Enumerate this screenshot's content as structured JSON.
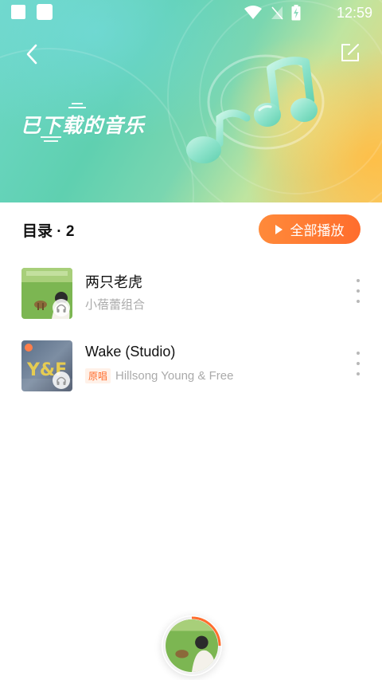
{
  "status_bar": {
    "time": "12:59"
  },
  "header": {
    "title": "已下载的音乐",
    "back_icon": "chevron-left-icon",
    "edit_icon": "edit-icon"
  },
  "list": {
    "header": "目录 · 2",
    "play_all_label": "全部播放"
  },
  "songs": [
    {
      "title": "两只老虎",
      "artist": "小蓓蕾组合",
      "badge": ""
    },
    {
      "title": "Wake (Studio)",
      "artist": "Hillsong Young & Free",
      "badge": "原唱"
    }
  ],
  "colors": {
    "accent": "#ff6d2d",
    "header_gradient_start": "#6fd8c8",
    "header_gradient_end": "#f6cf72"
  }
}
